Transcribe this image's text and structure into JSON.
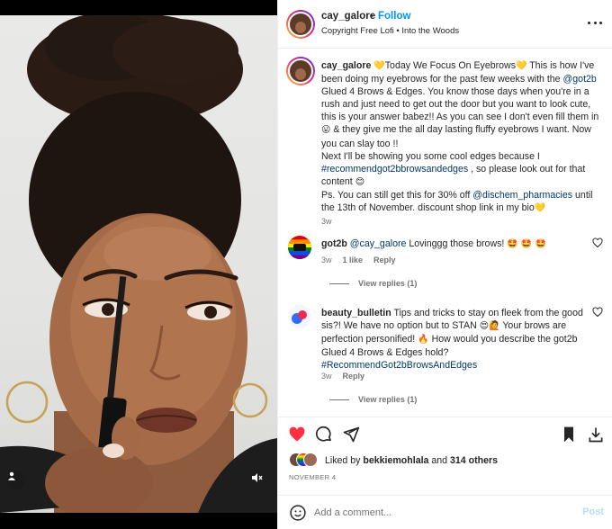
{
  "header": {
    "username": "cay_galore",
    "dot": "•",
    "follow_label": "Follow",
    "audio": "Copyright Free Lofi • Into the Woods"
  },
  "caption": {
    "username": "cay_galore",
    "p1": "Today We Focus On Eyebrows",
    "p2": " This is how I've been doing my eyebrows for the past few weeks with the ",
    "mention1": "@got2b",
    "p3": " Glued 4 Brows & Edges. You know those days when you're in a rush and just need to get out the door but you want to look cute, this is your answer babez!! As you can see I don't even fill them in ",
    "p4": " & they give me the all day lasting fluffy eyebrows I want. Now you can slay too !!",
    "p5": "Next I'll be showing you some cool edges because I ",
    "hashtag": "#recommendgot2bbrowsandedges",
    "p6": " , so please look out for that content ",
    "p7": "Ps. You can still get this for 30% off ",
    "mention2": "@dischem_pharmacies",
    "p8": " until the 13th of November. discount shop link in my bio",
    "time": "3w"
  },
  "comments": [
    {
      "username": "got2b",
      "mention": "@cay_galore",
      "text": " Lovinggg those brows! ",
      "emojis": "🤩 🤩 🤩",
      "time": "3w",
      "likes": "1 like",
      "reply": "Reply",
      "view_replies": "View replies (1)"
    },
    {
      "username": "beauty_bulletin",
      "text_a": " Tips and tricks to stay on fleek from the good sis?! We have no option but to STAN ",
      "text_b": " Your brows are perfection personified! ",
      "text_c": " How would you describe the got2b Glued 4 Brows & Edges hold? ",
      "hashtag": "#RecommendGot2bBrowsAndEdges",
      "time": "3w",
      "reply": "Reply",
      "view_replies": "View replies (1)"
    }
  ],
  "likes": {
    "prefix": "Liked by ",
    "user": "bekkiemohlala",
    "middle": " and ",
    "count": "314 others"
  },
  "date": "NOVEMBER 4",
  "add_comment": {
    "placeholder": "Add a comment...",
    "post_label": "Post"
  },
  "icons": {
    "like": "heart-filled-icon",
    "comment": "comment-icon",
    "share": "share-icon",
    "save": "bookmark-icon",
    "download": "download-icon",
    "emoji": "emoji-icon",
    "more": "more-icon",
    "mute": "mute-icon",
    "user_tag": "user-tag-icon"
  },
  "colors": {
    "like_red": "#ff3040",
    "link_blue": "#00376b",
    "follow_blue": "#0095f6",
    "muted": "#737373"
  }
}
